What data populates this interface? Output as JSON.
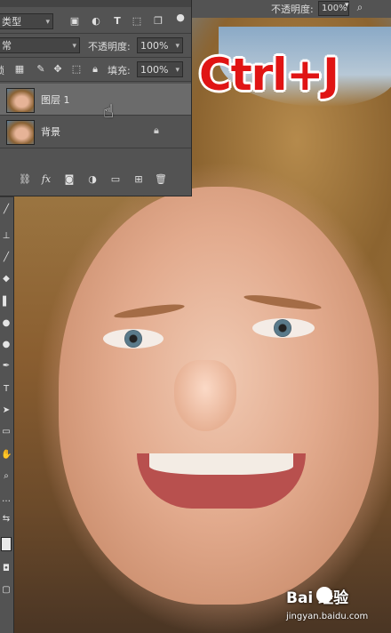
{
  "topbar": {
    "opacity_label": "不透明度:",
    "opacity_value": "100%"
  },
  "panel": {
    "filter_kind": "类型",
    "blend_mode": "常",
    "opacity_label": "不透明度:",
    "opacity_value": "100%",
    "lock_label": "锁",
    "fill_label": "填充:",
    "fill_value": "100%",
    "layers": [
      {
        "name": "图层 1",
        "locked": false,
        "selected": true
      },
      {
        "name": "背景",
        "locked": true,
        "selected": false
      }
    ],
    "footer_icons": [
      "link-icon",
      "fx-icon",
      "mask-icon",
      "adjustment-icon",
      "folder-icon",
      "new-layer-icon",
      "trash-icon"
    ],
    "fx_label": "fx"
  },
  "overlay": {
    "hotkey": "Ctrl+J"
  },
  "watermark": {
    "brand": "Bai  经验",
    "url": "jingyan.baidu.com"
  },
  "colors": {
    "panel_bg": "#535353",
    "selected_row": "#6b6b6b",
    "hotkey_red": "#e01414"
  }
}
